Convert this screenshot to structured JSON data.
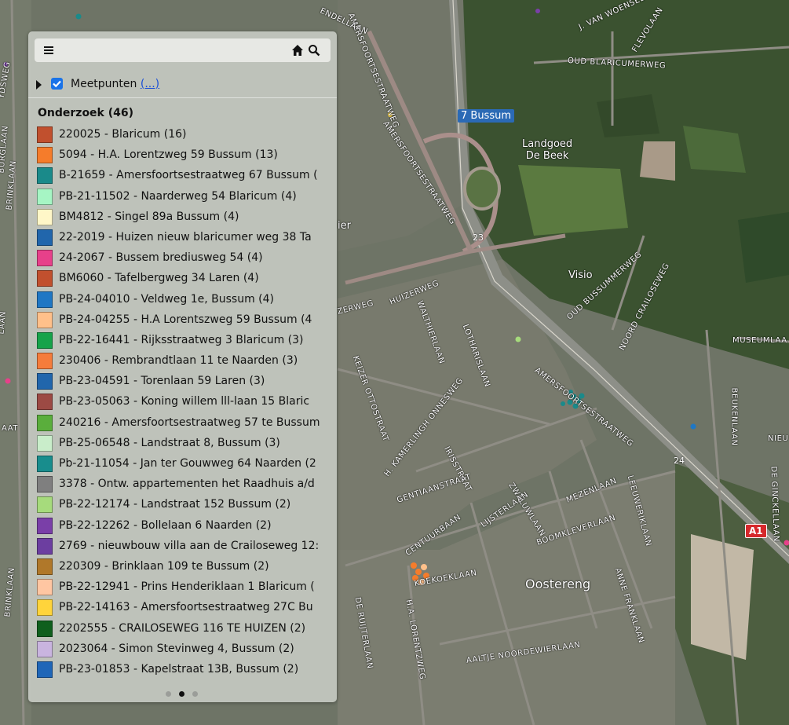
{
  "panel": {
    "menu_icon": "hamburger-icon",
    "home_icon": "home-icon",
    "search_icon": "search-icon",
    "layer": {
      "checked": true,
      "label": "Meetpunten",
      "more_link": "(...)"
    },
    "group_title": "Onderzoek (46)",
    "items": [
      {
        "label": "220025 - Blaricum (16)",
        "color": "#c1502e"
      },
      {
        "label": "5094 - H.A. Lorentzweg 59 Bussum (13)",
        "color": "#f57c2b"
      },
      {
        "label": "B-21659 - Amersfoortsestraatweg 67 Bussum (",
        "color": "#1a8a8a"
      },
      {
        "label": "PB-21-11502 - Naarderweg 54 Blaricum (4)",
        "color": "#a6f5c4"
      },
      {
        "label": "BM4812 - Singel 89a Bussum (4)",
        "color": "#fff7c8"
      },
      {
        "label": "22-2019 - Huizen nieuw blaricumer weg 38 Ta",
        "color": "#2166ac"
      },
      {
        "label": "24-2067 - Bussem brediusweg 54 (4)",
        "color": "#e7408a"
      },
      {
        "label": "BM6060 - Tafelbergweg 34 Laren (4)",
        "color": "#c1502e"
      },
      {
        "label": "PB-24-04010 - Veldweg 1e, Bussum (4)",
        "color": "#1f77c4"
      },
      {
        "label": "PB-24-04255 - H.A Lorentszweg 59 Bussum (4",
        "color": "#ffc08a"
      },
      {
        "label": "PB-22-16441 - Rijksstraatweg 3 Blaricum (3)",
        "color": "#16a34a"
      },
      {
        "label": "230406 - Rembrandtlaan 11 te Naarden (3)",
        "color": "#f57c3b"
      },
      {
        "label": "PB-23-04591 - Torenlaan 59 Laren (3)",
        "color": "#2166ac"
      },
      {
        "label": "PB-23-05063 - Koning willem lll-laan 15 Blaric",
        "color": "#9c4a44"
      },
      {
        "label": "240216 - Amersfoortsestraatweg 57 te Bussum",
        "color": "#5aae3c"
      },
      {
        "label": "PB-25-06548 - Landstraat 8, Bussum (3)",
        "color": "#c9edca"
      },
      {
        "label": "Pb-21-11054 - Jan ter Gouwweg 64 Naarden (2",
        "color": "#188d8d"
      },
      {
        "label": "3378 - Ontw. appartementen het Raadhuis a/d",
        "color": "#7f7f7f"
      },
      {
        "label": "PB-22-12174 - Landstraat 152 Bussum (2)",
        "color": "#a6db7c"
      },
      {
        "label": "PB-22-12262 - Bollelaan 6 Naarden (2)",
        "color": "#7a3fa8"
      },
      {
        "label": "2769 - nieuwbouw villa aan de Crailoseweg 12:",
        "color": "#6c3ea0"
      },
      {
        "label": "220309 - Brinklaan 109 te Bussum (2)",
        "color": "#b0782a"
      },
      {
        "label": "PB-22-12941 - Prins Henderiklaan 1 Blaricum (",
        "color": "#ffc6a2"
      },
      {
        "label": "PB-22-14163 - Amersfoortsestraatweg 27C Bu",
        "color": "#ffd43b"
      },
      {
        "label": "2202555 - CRAILOSEWEG 116 TE HUIZEN (2)",
        "color": "#0f5f1d"
      },
      {
        "label": "2023064 - Simon Stevinweg 4, Bussum (2)",
        "color": "#c9b4df"
      },
      {
        "label": "PB-23-01853 - Kapelstraat 13B, Bussum (2)",
        "color": "#1f66b8"
      }
    ],
    "pager": {
      "pages": 3,
      "active_index": 1
    }
  },
  "map": {
    "exit_badge": "7 Bussum",
    "a1_badge": "A1",
    "road_numbers": [
      "23",
      "24"
    ],
    "places": [
      {
        "id": "landgoed",
        "text": "Landgoed\nDe Beek"
      },
      {
        "id": "visio",
        "text": "Visio"
      },
      {
        "id": "oostereng",
        "text": "Oostereng"
      },
      {
        "id": "fragment",
        "text": "ier"
      }
    ],
    "streets": [
      {
        "id": "amersfoortsestraatweg-top",
        "text": "AMERSFOORTSESTRAATWEG"
      },
      {
        "id": "amersfoortsestraatweg-main",
        "text": "AMERSFOORTSESTRAATWEG"
      },
      {
        "id": "amersfoortse-mid",
        "text": "AMERSFOORTSESTRAATWEG"
      },
      {
        "id": "oud-blaricumerweg",
        "text": "OUD BLARICUMERWEG"
      },
      {
        "id": "j-van-woensel",
        "text": "J. VAN WOENSEL"
      },
      {
        "id": "flevolaan",
        "text": "FLEVOLAAN"
      },
      {
        "id": "endellaan",
        "text": "ENDELLAAN"
      },
      {
        "id": "oud-bussummerweg",
        "text": "OUD BUSSUMMERWEG"
      },
      {
        "id": "noord-crailoseweg",
        "text": "NOORD CRAILOSEWEG"
      },
      {
        "id": "museumlaan",
        "text": "MUSEUMLAA"
      },
      {
        "id": "huizerweg-1",
        "text": "HUIZERWEG"
      },
      {
        "id": "huizerweg-2",
        "text": "ZERWEG"
      },
      {
        "id": "walthierlaan",
        "text": "WALTHIERLAAN"
      },
      {
        "id": "lotharislaan",
        "text": "LOTHARISLAAN"
      },
      {
        "id": "keizer-ottostraat",
        "text": "KEIZER OTTOSTRAAT"
      },
      {
        "id": "h-kamerlingh",
        "text": "H. KAMERLINGH ONNESWEG"
      },
      {
        "id": "irisstraat",
        "text": "IRISSTRAAT"
      },
      {
        "id": "gentiaanstraat",
        "text": "GENTIAANSTRAAT"
      },
      {
        "id": "zwaluwlaan",
        "text": "ZWALUWLAAN"
      },
      {
        "id": "mezenlaan",
        "text": "MEZENLAAN"
      },
      {
        "id": "leeuweriklaan",
        "text": "LEEUWERIKLAAN"
      },
      {
        "id": "boomkleverlaan",
        "text": "BOOMKLEVERLAAN"
      },
      {
        "id": "lijsterlaan",
        "text": "LIJSTERLAAN"
      },
      {
        "id": "centuurbaan",
        "text": "CENTUURBAAN"
      },
      {
        "id": "koekoeklaan",
        "text": "KOEKOEKLAAN"
      },
      {
        "id": "h-a-lorentzweg",
        "text": "H.A. LORENTZWEG"
      },
      {
        "id": "de-ruiterlaan",
        "text": "DE RUIJTERLAAN"
      },
      {
        "id": "aaltje-noordewierlaan",
        "text": "AALTJE NOORDEWIERLAAN"
      },
      {
        "id": "anne-franklaan",
        "text": "ANNE FRANKLAAN"
      },
      {
        "id": "beukenlaan",
        "text": "BEUKENLAAN"
      },
      {
        "id": "de-ginckellaan",
        "text": "DE GINCKELLAAN"
      },
      {
        "id": "nieu",
        "text": "NIEU"
      },
      {
        "id": "brinklaan-1",
        "text": "BRINKLAAN"
      },
      {
        "id": "brinklaan-2",
        "text": "BRINKLAAN"
      },
      {
        "id": "burglaan",
        "text": "BURGLAAN"
      },
      {
        "id": "ydsweg",
        "text": "YDSWEG"
      },
      {
        "id": "aat",
        "text": "AAT"
      },
      {
        "id": "laan-left",
        "text": "LAAN"
      }
    ]
  }
}
